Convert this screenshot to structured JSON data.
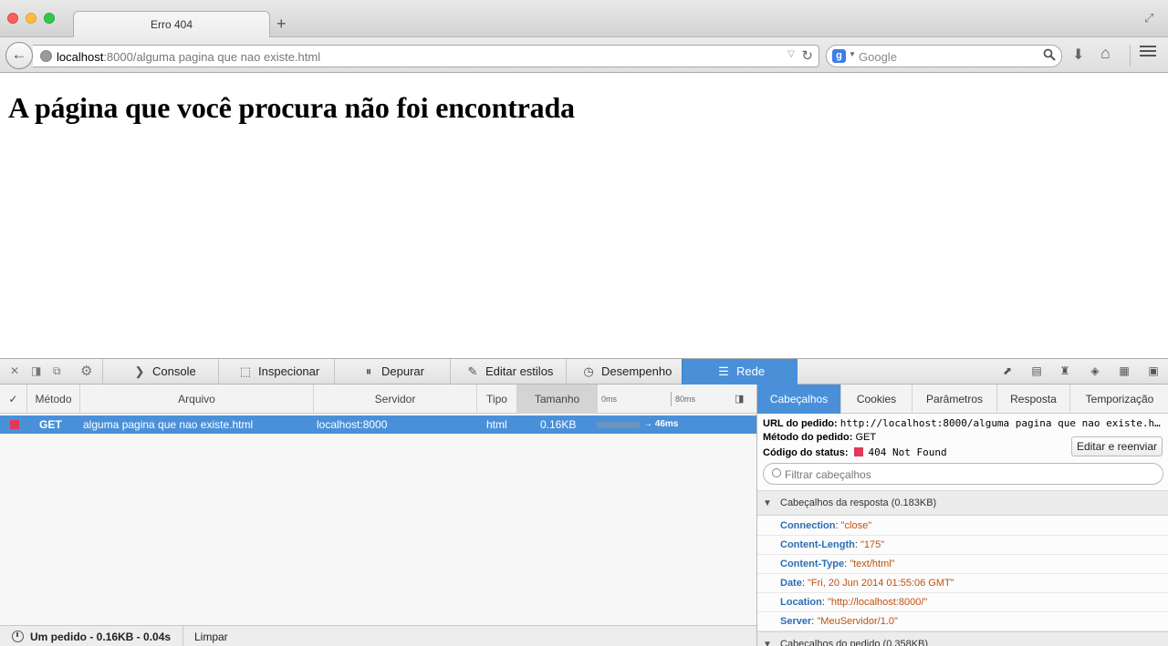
{
  "window": {
    "tab_title": "Erro 404",
    "new_tab": "+"
  },
  "navbar": {
    "url_host": "localhost",
    "url_rest": ":8000/alguma pagina que nao existe.html",
    "search_placeholder": "Google",
    "google_icon": "g"
  },
  "page": {
    "heading": "A página que você procura não foi encontrada"
  },
  "devtools": {
    "tabs": [
      {
        "label": "Console",
        "icon": "console-icon"
      },
      {
        "label": "Inspecionar",
        "icon": "inspector-icon"
      },
      {
        "label": "Depurar",
        "icon": "debugger-icon"
      },
      {
        "label": "Editar estilos",
        "icon": "style-editor-icon"
      },
      {
        "label": "Desempenho",
        "icon": "performance-icon"
      },
      {
        "label": "Rede",
        "icon": "network-icon",
        "active": true
      }
    ],
    "network": {
      "columns": {
        "check": "✓",
        "method": "Método",
        "file": "Arquivo",
        "server": "Servidor",
        "type": "Tipo",
        "size": "Tamanho",
        "tick0": "0ms",
        "tick80": "80ms"
      },
      "request": {
        "method": "GET",
        "file": "alguma pagina que nao existe.html",
        "server": "localhost:8000",
        "type": "html",
        "size": "0.16KB",
        "timing": "→ 46ms",
        "status_color": "#e0395a"
      },
      "footer": {
        "summary": "Um pedido - 0.16KB - 0.04s",
        "clear": "Limpar"
      }
    },
    "details": {
      "tabs": [
        "Cabeçalhos",
        "Cookies",
        "Parâmetros",
        "Resposta",
        "Temporização"
      ],
      "active_tab": "Cabeçalhos",
      "request_url_label": "URL do pedido:",
      "request_url": "http://localhost:8000/alguma pagina que nao existe.h…",
      "request_method_label": "Método do pedido:",
      "request_method": "GET",
      "status_label": "Código do status:",
      "status": "404 Not Found",
      "resend_button": "Editar e reenviar",
      "filter_placeholder": "Filtrar cabeçalhos",
      "response_section": "Cabeçalhos da resposta (0.183KB)",
      "request_section": "Cabeçalhos do pedido (0.358KB)",
      "response_headers": [
        {
          "name": "Connection",
          "value": "\"close\""
        },
        {
          "name": "Content-Length",
          "value": "\"175\""
        },
        {
          "name": "Content-Type",
          "value": "\"text/html\""
        },
        {
          "name": "Date",
          "value": "\"Fri, 20 Jun 2014 01:55:06 GMT\""
        },
        {
          "name": "Location",
          "value": "\"http://localhost:8000/\""
        },
        {
          "name": "Server",
          "value": "\"MeuServidor/1.0\""
        }
      ]
    }
  }
}
